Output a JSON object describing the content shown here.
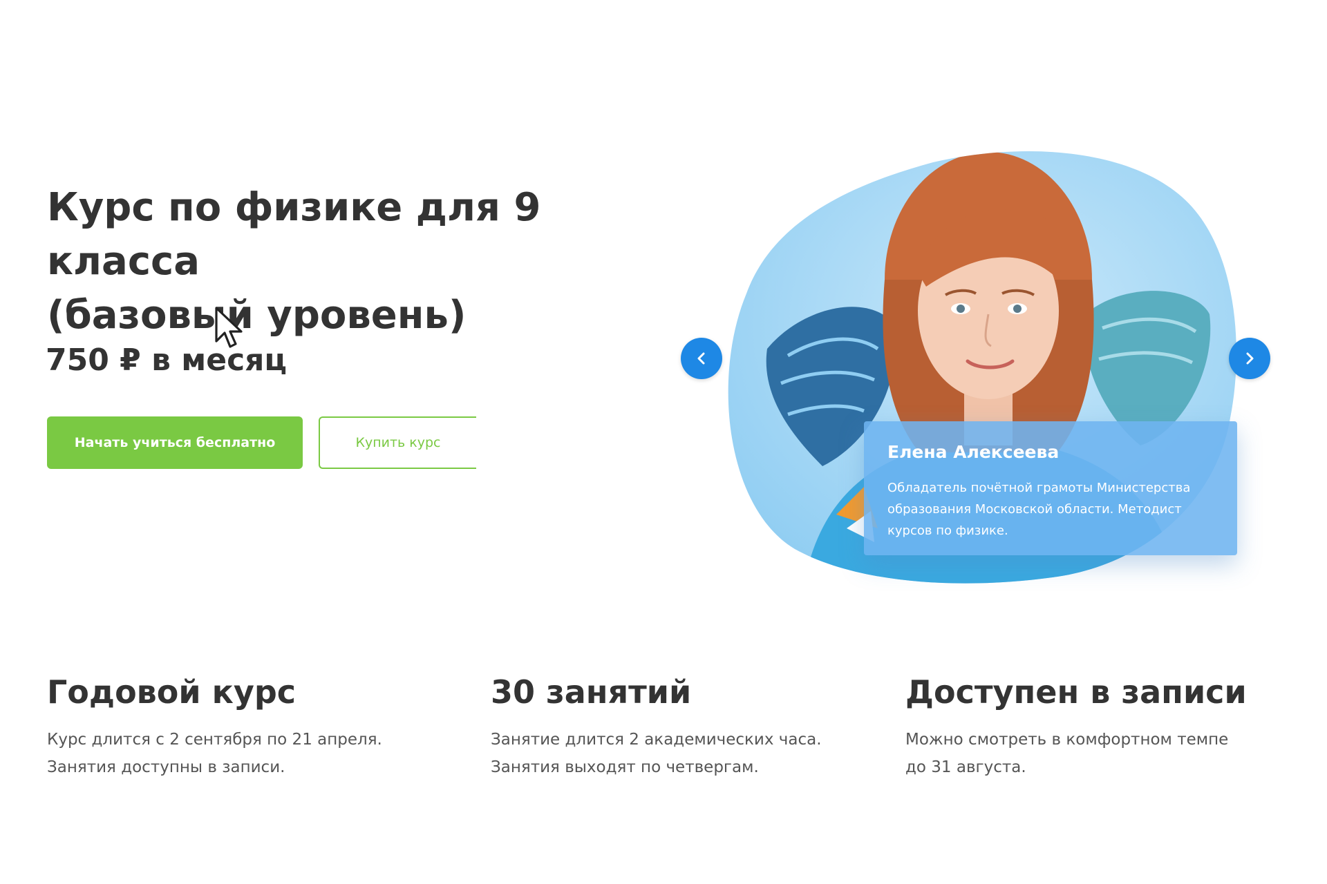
{
  "course": {
    "title_line1": "Курс по физике для 9 класса",
    "title_line2": "(базовый уровень)",
    "price": "750 ₽ в месяц"
  },
  "buttons": {
    "start_free": "Начать учиться бесплатно",
    "buy_course": "Купить курс"
  },
  "teacher": {
    "name": "Елена Алексеева",
    "description": "Обладатель почётной грамоты Министерства образования Московской области. Методист курсов по физике."
  },
  "features": [
    {
      "title": "Годовой курс",
      "line1": "Курс длится с 2 сентября по 21 апреля.",
      "line2": "Занятия доступны в записи."
    },
    {
      "title": "30 занятий",
      "line1": "Занятие длится 2 академических часа.",
      "line2": "Занятия выходят по четвергам."
    },
    {
      "title": "Доступен в записи",
      "line1": "Можно смотреть в комфортном темпе",
      "line2": "до 31 августа."
    }
  ],
  "icons": {
    "prev": "chevron-left-icon",
    "next": "chevron-right-icon",
    "cursor": "mouse-pointer-icon"
  },
  "colors": {
    "primary_green": "#7ac943",
    "accent_blue": "#1e88e5",
    "blob_blue": "#a8d8f5",
    "card_blue": "#6eb4f0",
    "text_dark": "#333333"
  }
}
